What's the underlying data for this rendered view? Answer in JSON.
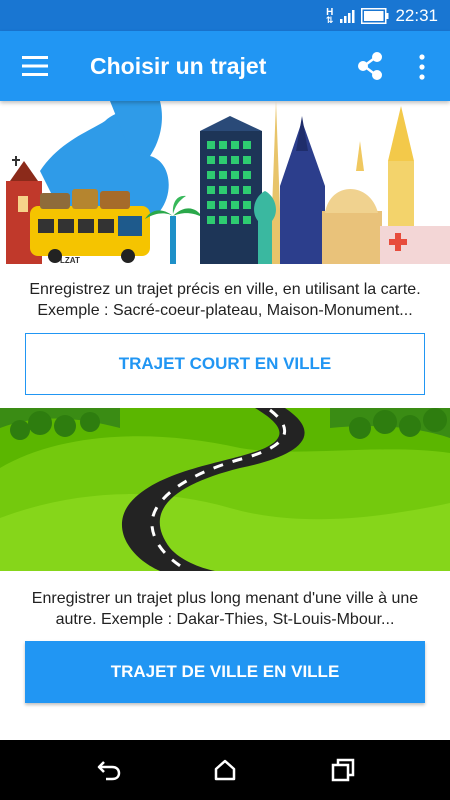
{
  "status_bar": {
    "network": "H",
    "time": "22:31"
  },
  "app_bar": {
    "title": "Choisir un trajet",
    "icons": [
      "menu-icon",
      "share-icon",
      "more-vert-icon"
    ]
  },
  "city_section": {
    "description": "Enregistrez un trajet précis en ville, en utilisant la carte. Exemple : Sacré-coeur-plateau, Maison-Monument...",
    "button_label": "TRAJET COURT EN VILLE",
    "bus_sign": "LZAT"
  },
  "road_section": {
    "description": "Enregistrer un trajet plus long menant d'une ville à une autre. Exemple : Dakar-Thies, St-Louis-Mbour...",
    "button_label": "TRAJET DE VILLE EN VILLE"
  },
  "nav_bar": {
    "icons": [
      "back-icon",
      "home-icon",
      "recents-icon"
    ]
  },
  "colors": {
    "status_bar": "#1976d2",
    "app_bar": "#2196f3",
    "accent": "#2196f3",
    "grass": "#5cb800",
    "road": "#222222",
    "nav_bar": "#000000"
  }
}
